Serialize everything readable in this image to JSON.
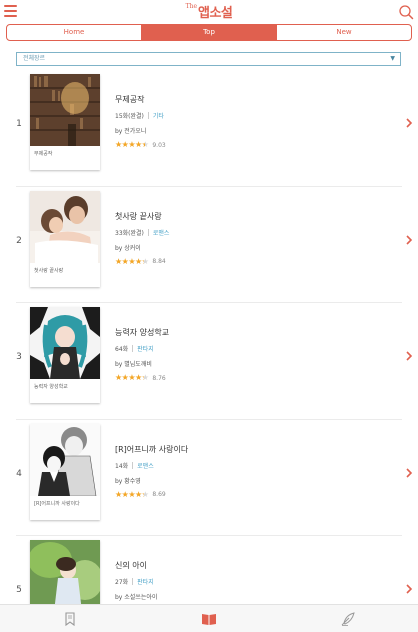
{
  "header": {
    "logo_prefix": "The",
    "logo_name": "앱소설",
    "menu_icon": "hamburger-icon",
    "search_icon": "search-icon"
  },
  "tabs": [
    {
      "label": "Home",
      "active": false
    },
    {
      "label": "Top",
      "active": true
    },
    {
      "label": "New",
      "active": false
    }
  ],
  "filter": {
    "genre_selected": "전체장르",
    "caret_icon": "caret-down-icon"
  },
  "novels": [
    {
      "rank": "1",
      "title": "무제공작",
      "episodes": "15화(완결)",
      "genre": "기타",
      "author": "by 전가오니",
      "rating_value": 9.03,
      "rating_text": "9.03",
      "cover_caption": "무제공작"
    },
    {
      "rank": "2",
      "title": "첫사랑 끝사랑",
      "episodes": "33화(완결)",
      "genre": "로맨스",
      "author": "by 상커이",
      "rating_value": 8.84,
      "rating_text": "8.84",
      "cover_caption": "첫사랑 끝사랑"
    },
    {
      "rank": "3",
      "title": "능력자 양성학교",
      "episodes": "64화",
      "genre": "판타지",
      "author": "by 별님도깨비",
      "rating_value": 8.76,
      "rating_text": "8.76",
      "cover_caption": "능력자 양성학교"
    },
    {
      "rank": "4",
      "title": "[R]어프니까 사랑이다",
      "episodes": "14화",
      "genre": "로맨스",
      "author": "by 황수영",
      "rating_value": 8.69,
      "rating_text": "8.69",
      "cover_caption": "[R]어프니까 사랑이다"
    },
    {
      "rank": "5",
      "title": "신의 아이",
      "episodes": "27화",
      "genre": "판타지",
      "author": "by 소설쓰는아이",
      "rating_value": 0,
      "rating_text": "",
      "cover_caption": ""
    }
  ],
  "bottom_nav": [
    {
      "icon": "bookmark-icon",
      "active": false
    },
    {
      "icon": "book-icon",
      "active": true
    },
    {
      "icon": "quill-icon",
      "active": false
    }
  ],
  "colors": {
    "accent": "#e0604f",
    "genre_link": "#4aa3c8",
    "star": "#f5a623"
  }
}
